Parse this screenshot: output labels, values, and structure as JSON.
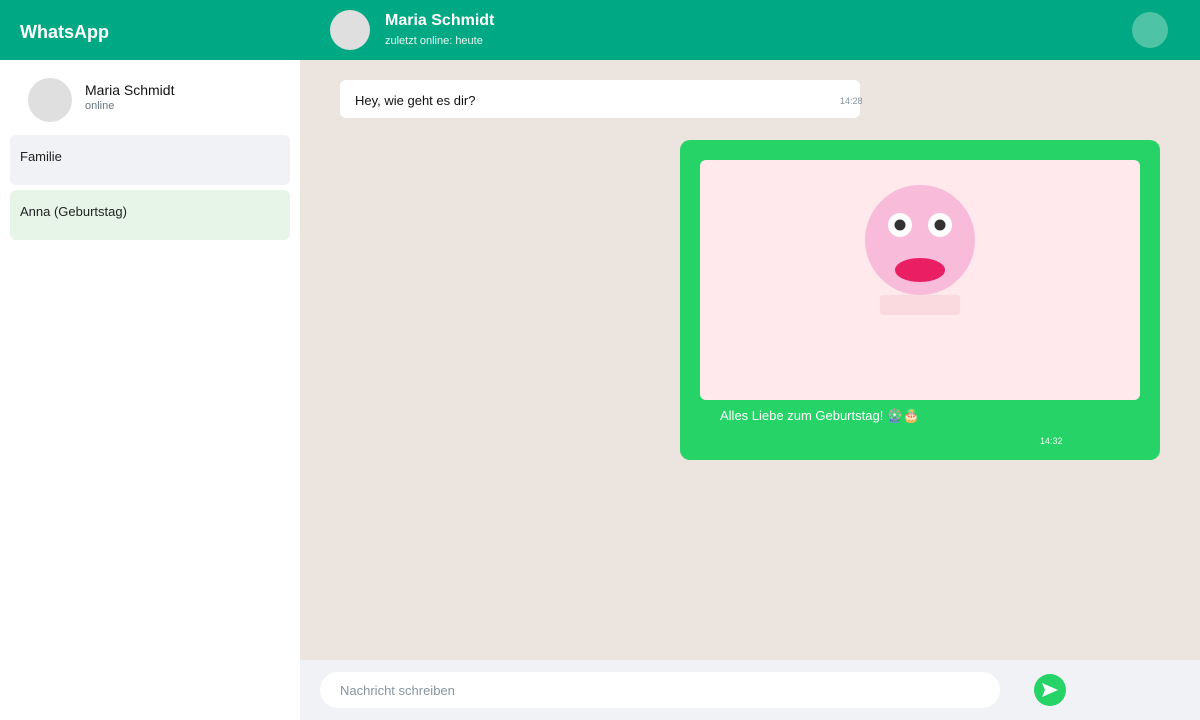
{
  "app": {
    "title": "WhatsApp"
  },
  "sidebar": {
    "profile": {
      "name": "Maria Schmidt",
      "status": "online"
    },
    "chats": [
      {
        "label": "Familie"
      },
      {
        "label": "Anna (Geburtstag)"
      }
    ]
  },
  "header": {
    "contact_name": "Maria Schmidt",
    "contact_status": "zuletzt online: heute"
  },
  "messages": [
    {
      "direction": "incoming",
      "text": "Hey, wie geht es dir?",
      "time": "14:28"
    },
    {
      "direction": "outgoing",
      "has_image": true,
      "text": "Alles Liebe zum Geburtstag! 🎡🎂",
      "time": "14:32"
    }
  ],
  "composer": {
    "placeholder": "Nachricht schreiben",
    "value": ""
  },
  "icons": {
    "send": "send-icon"
  },
  "colors": {
    "header_green": "#00a884",
    "bubble_green": "#25d366",
    "chat_background": "#ece5df",
    "incoming_bubble": "#ffffff",
    "image_background": "#ffe9ed",
    "face_pink": "#f8bbd9",
    "mouth_red": "#e91e63"
  }
}
